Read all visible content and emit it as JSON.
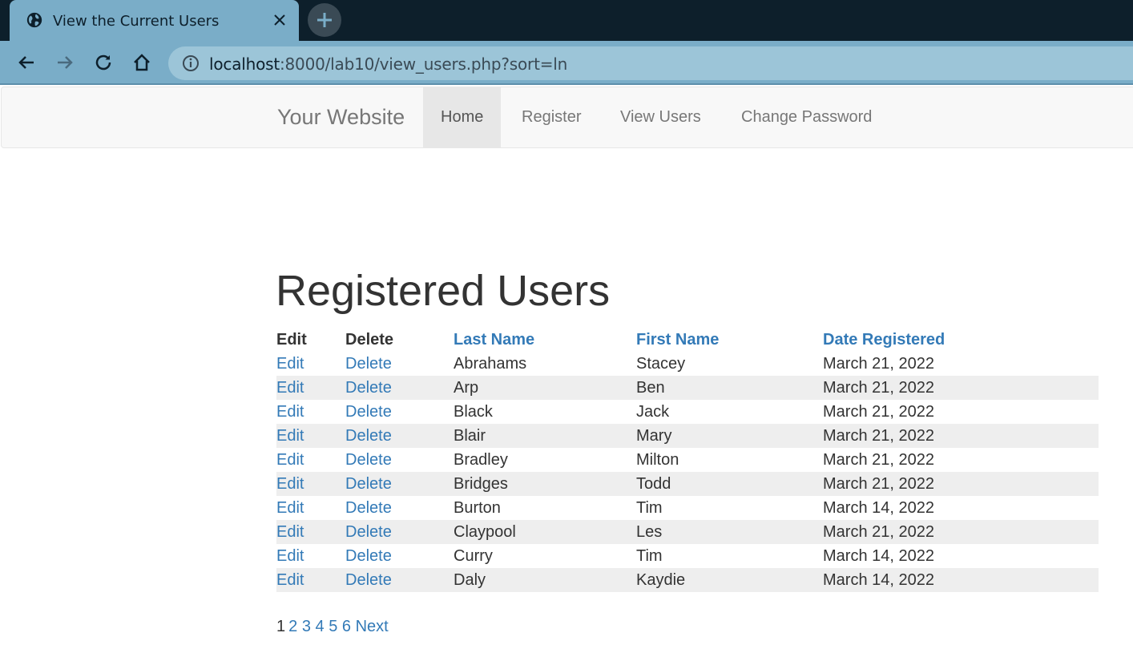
{
  "browser": {
    "tab_title": "View the Current Users",
    "url_host": "localhost",
    "url_path": ":8000/lab10/view_users.php?sort=ln"
  },
  "site": {
    "brand": "Your Website",
    "nav": [
      {
        "label": "Home",
        "active": true
      },
      {
        "label": "Register",
        "active": false
      },
      {
        "label": "View Users",
        "active": false
      },
      {
        "label": "Change Password",
        "active": false
      }
    ]
  },
  "main": {
    "title": "Registered Users",
    "headers": {
      "edit": "Edit",
      "delete": "Delete",
      "last_name": "Last Name",
      "first_name": "First Name",
      "date_registered": "Date Registered"
    },
    "rows": [
      {
        "edit": "Edit",
        "delete": "Delete",
        "last": "Abrahams",
        "first": "Stacey",
        "date": "March 21, 2022"
      },
      {
        "edit": "Edit",
        "delete": "Delete",
        "last": "Arp",
        "first": "Ben",
        "date": "March 21, 2022"
      },
      {
        "edit": "Edit",
        "delete": "Delete",
        "last": "Black",
        "first": "Jack",
        "date": "March 21, 2022"
      },
      {
        "edit": "Edit",
        "delete": "Delete",
        "last": "Blair",
        "first": "Mary",
        "date": "March 21, 2022"
      },
      {
        "edit": "Edit",
        "delete": "Delete",
        "last": "Bradley",
        "first": "Milton",
        "date": "March 21, 2022"
      },
      {
        "edit": "Edit",
        "delete": "Delete",
        "last": "Bridges",
        "first": "Todd",
        "date": "March 21, 2022"
      },
      {
        "edit": "Edit",
        "delete": "Delete",
        "last": "Burton",
        "first": "Tim",
        "date": "March 14, 2022"
      },
      {
        "edit": "Edit",
        "delete": "Delete",
        "last": "Claypool",
        "first": "Les",
        "date": "March 21, 2022"
      },
      {
        "edit": "Edit",
        "delete": "Delete",
        "last": "Curry",
        "first": "Tim",
        "date": "March 14, 2022"
      },
      {
        "edit": "Edit",
        "delete": "Delete",
        "last": "Daly",
        "first": "Kaydie",
        "date": "March 14, 2022"
      }
    ],
    "pagination": {
      "current": "1",
      "pages": [
        "2",
        "3",
        "4",
        "5",
        "6"
      ],
      "next": "Next"
    }
  },
  "colors": {
    "link": "#337ab7",
    "text": "#333333",
    "stripe": "#eeeeee",
    "chrome_dark": "#0d1f2b",
    "chrome_tab": "#7aadc8"
  },
  "icons": {
    "tab": "globe-icon",
    "close": "close-icon",
    "new_tab": "plus-icon",
    "back": "back-arrow-icon",
    "forward": "forward-arrow-icon",
    "reload": "reload-icon",
    "home": "home-icon",
    "site_info": "info-icon"
  }
}
